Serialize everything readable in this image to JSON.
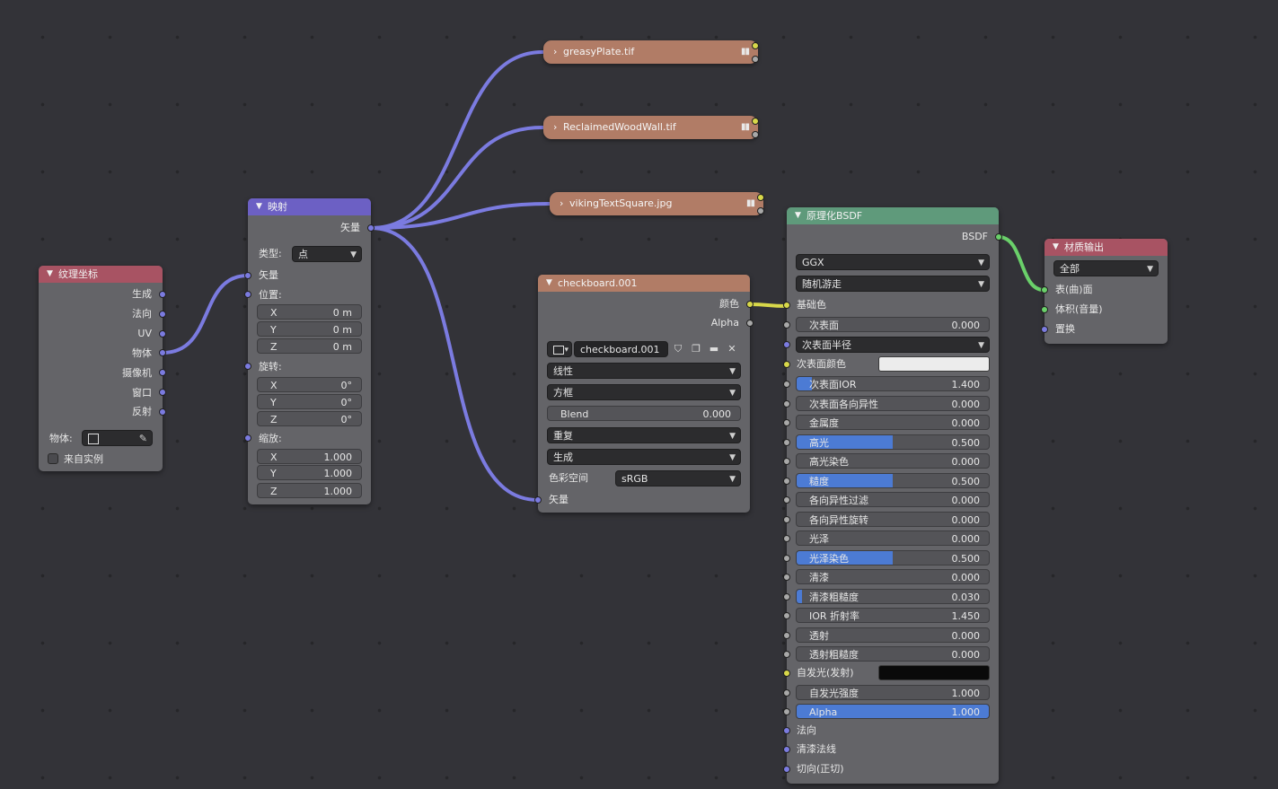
{
  "colors": {
    "background": "#333338",
    "node_body": "#646468",
    "header_input": "#a85363",
    "header_vector": "#6c60c4",
    "header_texture": "#b17c66",
    "header_shader": "#5f9a7b",
    "header_output": "#a85363",
    "wire_vector": "#7b7be0",
    "wire_color": "#d8d84a",
    "wire_shader": "#6ad06a",
    "slider_fill": "#4c7bd4"
  },
  "tex_coord": {
    "title": "纹理坐标",
    "outputs": [
      "生成",
      "法向",
      "UV",
      "物体",
      "摄像机",
      "窗口",
      "反射"
    ],
    "object_label": "物体:",
    "from_instancer_label": "来自实例"
  },
  "mapping": {
    "title": "映射",
    "output_label": "矢量",
    "type_label": "类型:",
    "type_value": "点",
    "vector_label": "矢量",
    "location_label": "位置:",
    "location": [
      {
        "axis": "X",
        "value": "0 m"
      },
      {
        "axis": "Y",
        "value": "0 m"
      },
      {
        "axis": "Z",
        "value": "0 m"
      }
    ],
    "rotation_label": "旋转:",
    "rotation": [
      {
        "axis": "X",
        "value": "0°"
      },
      {
        "axis": "Y",
        "value": "0°"
      },
      {
        "axis": "Z",
        "value": "0°"
      }
    ],
    "scale_label": "缩放:",
    "scale": [
      {
        "axis": "X",
        "value": "1.000"
      },
      {
        "axis": "Y",
        "value": "1.000"
      },
      {
        "axis": "Z",
        "value": "1.000"
      }
    ]
  },
  "collapsed_images": [
    {
      "label": "greasyPlate.tif"
    },
    {
      "label": "ReclaimedWoodWall.tif"
    },
    {
      "label": "vikingTextSquare.jpg"
    }
  ],
  "checkboard": {
    "title": "checkboard.001",
    "outputs": [
      "颜色",
      "Alpha"
    ],
    "image_name": "checkboard.001",
    "interpolation": "线性",
    "projection": "方框",
    "blend_label": "Blend",
    "blend_value": "0.000",
    "extension": "重复",
    "source": "生成",
    "colorspace_label": "色彩空间",
    "colorspace_value": "sRGB",
    "vector_input": "矢量"
  },
  "bsdf": {
    "title": "原理化BSDF",
    "output_label": "BSDF",
    "distribution": "GGX",
    "subsurface_method": "随机游走",
    "base_color_label": "基础色",
    "subsurface_label": "次表面",
    "subsurface_value": "0.000",
    "subsurface_radius_label": "次表面半径",
    "subsurface_color_label": "次表面颜色",
    "subsurface_color": "#ececec",
    "emission_color": "#0a0a0a",
    "rows": [
      {
        "label": "次表面IOR",
        "value": "1.400",
        "fill": 0.08
      },
      {
        "label": "次表面各向异性",
        "value": "0.000",
        "fill": 0
      },
      {
        "label": "金属度",
        "value": "0.000",
        "fill": 0
      },
      {
        "label": "高光",
        "value": "0.500",
        "fill": 0.5
      },
      {
        "label": "高光染色",
        "value": "0.000",
        "fill": 0
      },
      {
        "label": "糙度",
        "value": "0.500",
        "fill": 0.5
      },
      {
        "label": "各向异性过滤",
        "value": "0.000",
        "fill": 0
      },
      {
        "label": "各向异性旋转",
        "value": "0.000",
        "fill": 0
      },
      {
        "label": "光泽",
        "value": "0.000",
        "fill": 0
      },
      {
        "label": "光泽染色",
        "value": "0.500",
        "fill": 0.5
      },
      {
        "label": "清漆",
        "value": "0.000",
        "fill": 0
      },
      {
        "label": "清漆粗糙度",
        "value": "0.030",
        "fill": 0.03
      },
      {
        "label": "IOR 折射率",
        "value": "1.450",
        "fill": 0
      },
      {
        "label": "透射",
        "value": "0.000",
        "fill": 0
      },
      {
        "label": "透射粗糙度",
        "value": "0.000",
        "fill": 0
      }
    ],
    "emission_label": "自发光(发射)",
    "emission_strength_label": "自发光强度",
    "emission_strength_value": "1.000",
    "alpha_label": "Alpha",
    "alpha_value": "1.000",
    "alpha_fill": 1,
    "normal_label": "法向",
    "clearcoat_normal_label": "清漆法线",
    "tangent_label": "切向(正切)"
  },
  "material_output": {
    "title": "材质输出",
    "target": "全部",
    "inputs": [
      "表(曲)面",
      "体积(音量)",
      "置换"
    ]
  }
}
